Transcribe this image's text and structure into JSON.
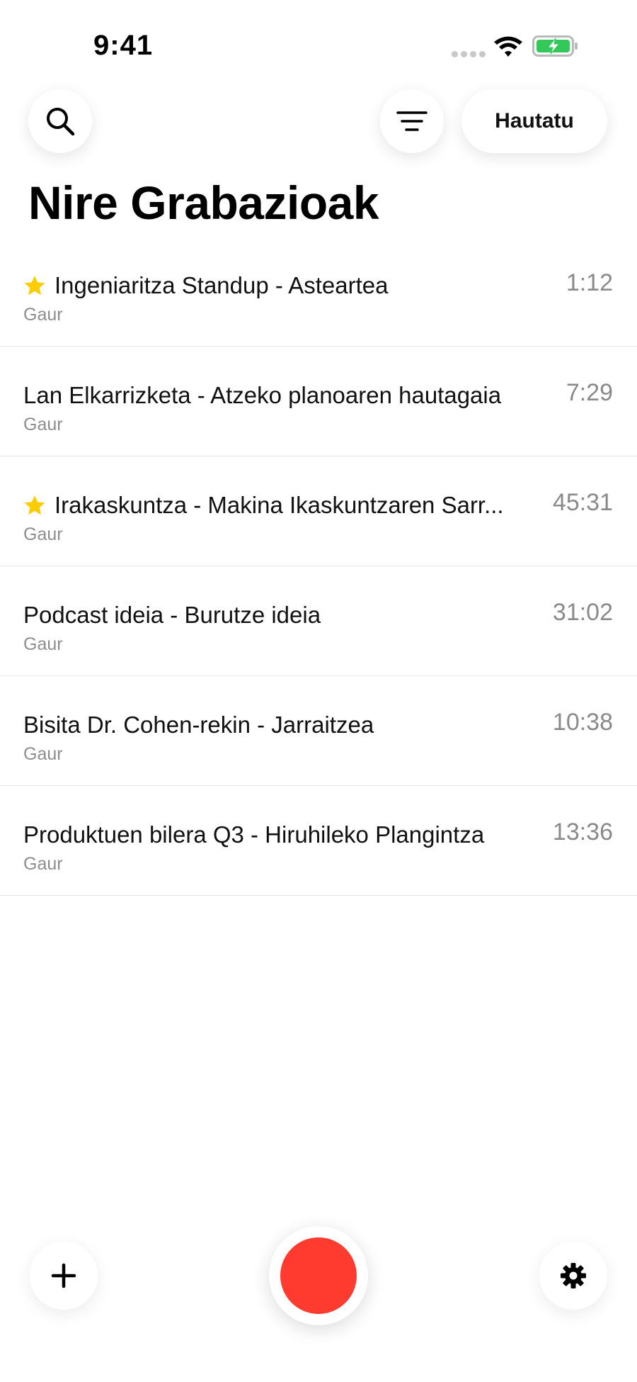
{
  "status_bar": {
    "time": "9:41",
    "battery_color": "#34c759"
  },
  "toolbar": {
    "search_icon": "search-icon",
    "filter_icon": "filter-icon",
    "select_label": "Hautatu"
  },
  "page": {
    "title": "Nire Grabazioak"
  },
  "recordings": [
    {
      "title": "Ingeniaritza Standup - Asteartea",
      "date": "Gaur",
      "duration": "1:12",
      "starred": true
    },
    {
      "title": "Lan Elkarrizketa - Atzeko planoaren hautagaia",
      "date": "Gaur",
      "duration": "7:29",
      "starred": false
    },
    {
      "title": "Irakaskuntza - Makina Ikaskuntzaren Sarr...",
      "date": "Gaur",
      "duration": "45:31",
      "starred": true
    },
    {
      "title": "Podcast ideia - Burutze ideia",
      "date": "Gaur",
      "duration": "31:02",
      "starred": false
    },
    {
      "title": "Bisita Dr. Cohen-rekin - Jarraitzea",
      "date": "Gaur",
      "duration": "10:38",
      "starred": false
    },
    {
      "title": "Produktuen bilera Q3 - Hiruhileko Plangintza",
      "date": "Gaur",
      "duration": "13:36",
      "starred": false
    }
  ],
  "bottom_bar": {
    "add_icon": "plus-icon",
    "record_color": "#ff3b30",
    "settings_icon": "gear-icon"
  },
  "colors": {
    "star": "#ffcc00",
    "record": "#ff3b30",
    "secondary_text": "#8e8e8e"
  }
}
